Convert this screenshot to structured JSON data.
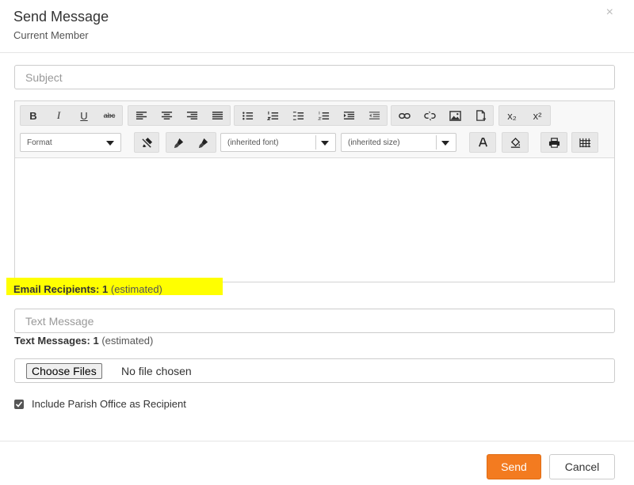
{
  "modal": {
    "title": "Send Message",
    "subtitle": "Current Member",
    "close_glyph": "×"
  },
  "subject": {
    "placeholder": "Subject",
    "value": ""
  },
  "editor": {
    "toolbar_row1": [
      [
        "bold",
        "italic",
        "underline",
        "strikethrough"
      ],
      [
        "align-left",
        "align-center",
        "align-right",
        "align-justify"
      ],
      [
        "bulleted-list",
        "numbered-list",
        "decrease-indent-list",
        "numbered-list-alt",
        "indent",
        "outdent"
      ],
      [
        "link",
        "unlink",
        "image",
        "file"
      ],
      [
        "subscript",
        "superscript"
      ]
    ],
    "labels": {
      "bold": "B",
      "italic": "I",
      "underline": "U",
      "strike": "abc",
      "sub": "x₂",
      "sup": "x²"
    },
    "format_select": "Format",
    "font_select": "(inherited font)",
    "size_select": "(inherited size)"
  },
  "email_recipients": {
    "label": "Email Recipients:",
    "count": "1",
    "suffix": "(estimated)"
  },
  "text_message": {
    "placeholder": "Text Message",
    "value": ""
  },
  "text_messages": {
    "label": "Text Messages:",
    "count": "1",
    "suffix": "(estimated)"
  },
  "file": {
    "button_label": "Choose Files",
    "status": "No file chosen"
  },
  "include_parish": {
    "label": "Include Parish Office as Recipient",
    "checked": true
  },
  "footer": {
    "send_label": "Send",
    "cancel_label": "Cancel"
  },
  "colors": {
    "accent": "#f37b20",
    "highlight": "#ffff00"
  }
}
